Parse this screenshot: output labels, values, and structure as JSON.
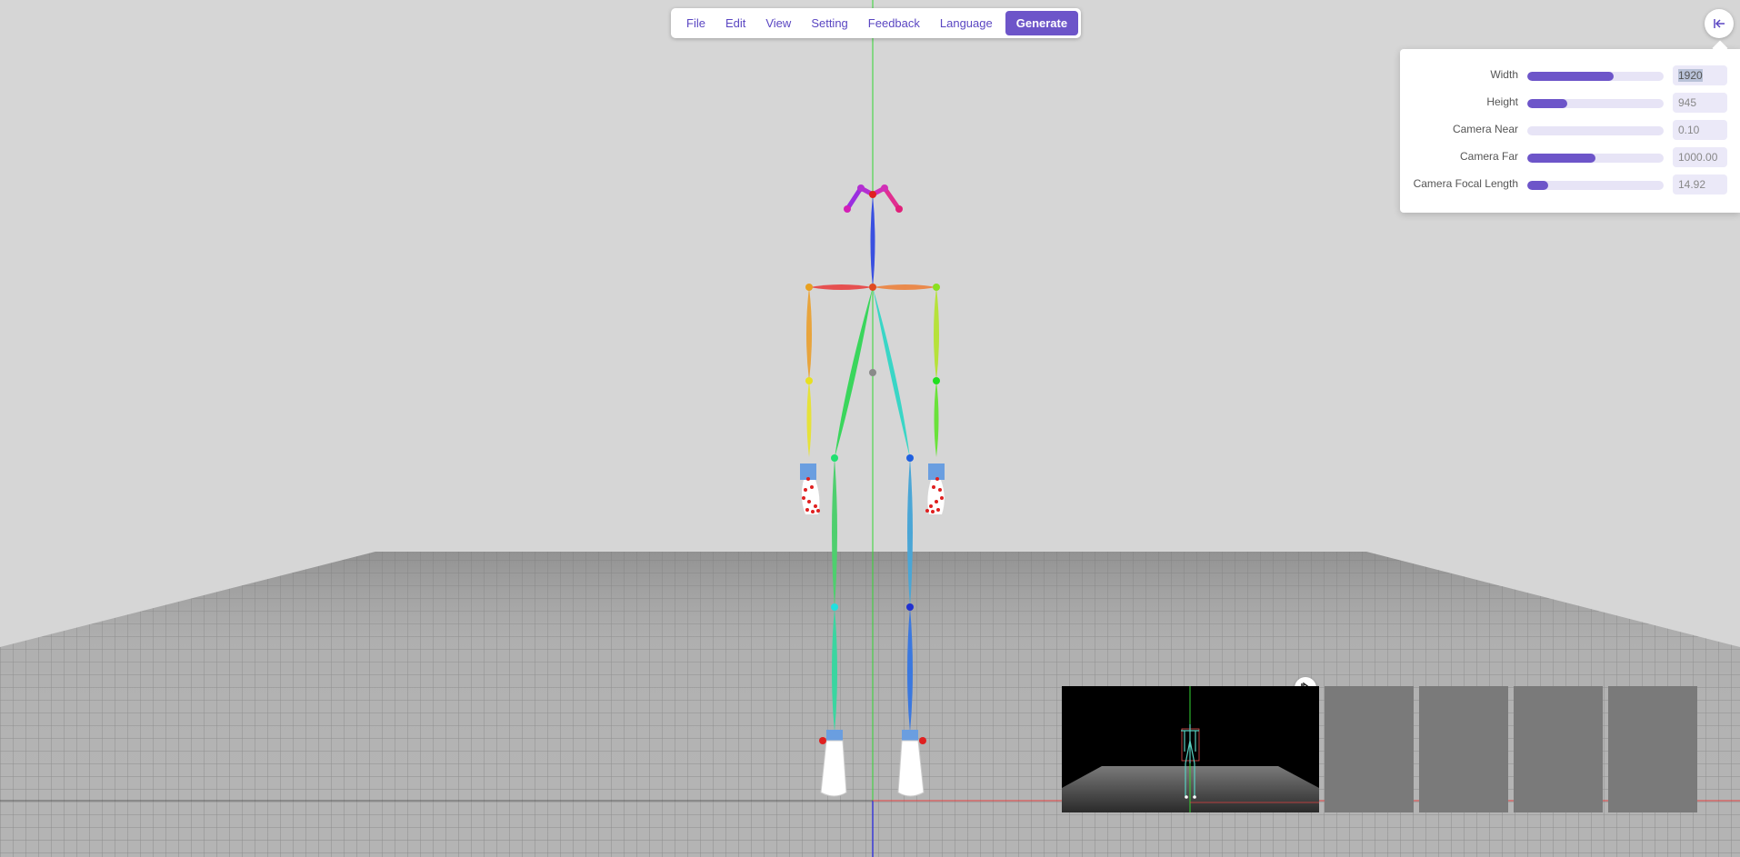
{
  "menu": {
    "file": "File",
    "edit": "Edit",
    "view": "View",
    "setting": "Setting",
    "feedback": "Feedback",
    "language": "Language",
    "generate": "Generate"
  },
  "panel": {
    "rows": [
      {
        "label": "Width",
        "value": "1920",
        "fill": 0.63
      },
      {
        "label": "Height",
        "value": "945",
        "fill": 0.29
      },
      {
        "label": "Camera Near",
        "value": "0.10",
        "fill": 0.0
      },
      {
        "label": "Camera Far",
        "value": "1000.00",
        "fill": 0.5
      },
      {
        "label": "Camera Focal Length",
        "value": "14.92",
        "fill": 0.15
      }
    ]
  },
  "icons": {
    "collapse": "collapse-panel-icon",
    "play": "play-icon",
    "lock": "lock-icon",
    "undo": "undo-icon"
  },
  "colors": {
    "accent": "#6d55c9",
    "background": "#d6d6d6"
  }
}
